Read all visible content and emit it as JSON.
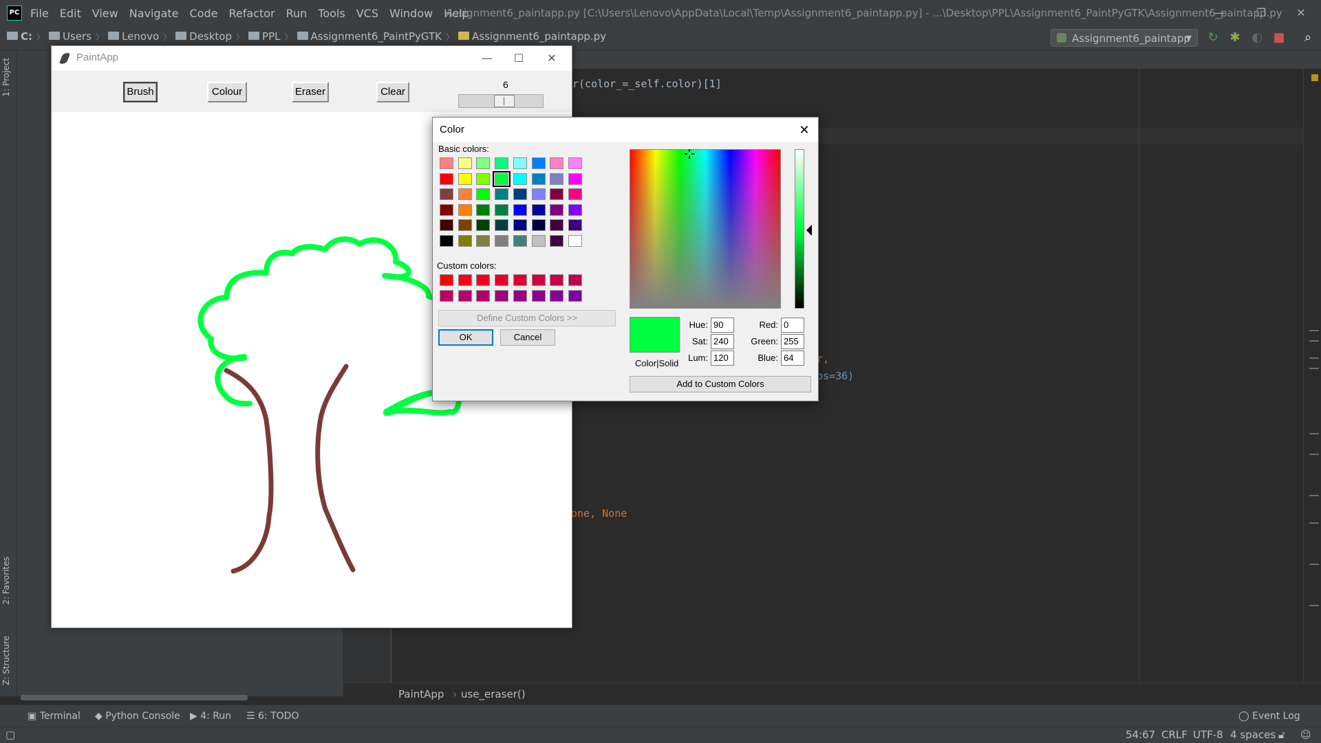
{
  "ide": {
    "menu": [
      "File",
      "Edit",
      "View",
      "Navigate",
      "Code",
      "Refactor",
      "Run",
      "Tools",
      "VCS",
      "Window",
      "Help"
    ],
    "window_title": "Assignment6_paintapp.py [C:\\Users\\Lenovo\\AppData\\Local\\Temp\\Assignment6_paintapp.py] - ...\\Desktop\\PPL\\Assignment6_PaintPyGTK\\Assignment6_paintapp.py",
    "breadcrumb": [
      "C:",
      "Users",
      "Lenovo",
      "Desktop",
      "PPL",
      "Assignment6_PaintPyGTK",
      "Assignment6_paintapp.py"
    ],
    "run_config": "Assignment6_paintapp",
    "left_tabs": {
      "project": "1: Project",
      "favorites": "2: Favorites",
      "structure": "Z: Structure"
    },
    "code_fragments": {
      "line1": "r(color_=_self.color)[1]",
      "line2": "or,",
      "line3": "eps=36)",
      "line4": "one, None"
    },
    "editor_breadcrumb": [
      "PaintApp",
      "use_eraser()"
    ],
    "tool_windows": [
      "Terminal",
      "Python Console",
      "4: Run",
      "6: TODO"
    ],
    "event_log": "Event Log",
    "status": {
      "position": "54:67",
      "line_sep": "CRLF",
      "encoding": "UTF-8",
      "indent": "4 spaces"
    }
  },
  "paint": {
    "title": "PaintApp",
    "buttons": [
      "Brush",
      "Colour",
      "Eraser",
      "Clear"
    ],
    "slider_value": "6",
    "stroke_colors": {
      "crown": "#00ff40",
      "trunk": "#7b3a36"
    }
  },
  "color_dialog": {
    "title": "Color",
    "basic_label": "Basic colors:",
    "custom_label": "Custom colors:",
    "basic_colors": [
      [
        "#ff8080",
        "#ffff80",
        "#80ff80",
        "#00ff80",
        "#80ffff",
        "#0080ff",
        "#ff80c0",
        "#ff80ff"
      ],
      [
        "#ff0000",
        "#ffff00",
        "#80ff00",
        "#00ff40",
        "#00ffff",
        "#0080c0",
        "#8080c0",
        "#ff00ff"
      ],
      [
        "#804040",
        "#ff8040",
        "#00ff00",
        "#008080",
        "#004080",
        "#8080ff",
        "#800040",
        "#ff0080"
      ],
      [
        "#800000",
        "#ff8000",
        "#008000",
        "#008040",
        "#0000ff",
        "#0000a0",
        "#800080",
        "#8000ff"
      ],
      [
        "#400000",
        "#804000",
        "#004000",
        "#004040",
        "#000080",
        "#000040",
        "#400040",
        "#400080"
      ],
      [
        "#000000",
        "#808000",
        "#808040",
        "#808080",
        "#408080",
        "#c0c0c0",
        "#400040",
        "#ffffff"
      ]
    ],
    "selected_basic": [
      1,
      3
    ],
    "custom_colors": [
      [
        "#ff0000",
        "#f80018",
        "#f00020",
        "#e80028",
        "#e00030",
        "#d00040",
        "#c80048",
        "#c00050"
      ],
      [
        "#c00060",
        "#b80068",
        "#b00070",
        "#a00080",
        "#980088",
        "#900090",
        "#880098",
        "#8000a0"
      ]
    ],
    "define_custom": "Define Custom Colors >>",
    "ok": "OK",
    "cancel": "Cancel",
    "color_solid": "Color|Solid",
    "add_custom": "Add to Custom Colors",
    "fields": {
      "hue_label": "Hue:",
      "hue": "90",
      "sat_label": "Sat:",
      "sat": "240",
      "lum_label": "Lum:",
      "lum": "120",
      "red_label": "Red:",
      "red": "0",
      "green_label": "Green:",
      "green": "255",
      "blue_label": "Blue:",
      "blue": "64"
    },
    "current_color": "#00ff40"
  }
}
